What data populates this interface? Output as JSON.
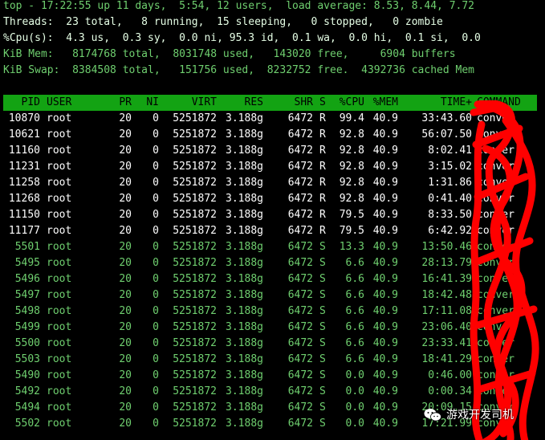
{
  "summary": {
    "line1": "top - 17:22:55 up 11 days,  5:54, 12 users,  load average: 8.53, 8.44, 7.72",
    "line2": "Threads:  23 total,   8 running,  15 sleeping,   0 stopped,   0 zombie",
    "line3": "%Cpu(s):  4.3 us,  0.3 sy,  0.0 ni, 95.3 id,  0.1 wa,  0.0 hi,  0.1 si,  0.0",
    "line4": "KiB Mem:   8174768 total,  8031748 used,   143020 free,     6904 buffers",
    "line5": "KiB Swap:  8384508 total,   151756 used,  8232752 free.  4392736 cached Mem"
  },
  "table": {
    "columns": [
      "PID",
      "USER",
      "PR",
      "NI",
      "VIRT",
      "RES",
      "SHR",
      "S",
      "%CPU",
      "%MEM",
      "TIME+",
      "COMMAND"
    ],
    "rows": [
      {
        "pid": "10870",
        "user": "root",
        "pr": "20",
        "ni": "0",
        "virt": "5251872",
        "res": "3.188g",
        "shr": "6472",
        "s": "R",
        "cpu": "99.4",
        "mem": "40.9",
        "time": "33:43.60",
        "cmd": "conver",
        "state": "running"
      },
      {
        "pid": "10621",
        "user": "root",
        "pr": "20",
        "ni": "0",
        "virt": "5251872",
        "res": "3.188g",
        "shr": "6472",
        "s": "R",
        "cpu": "92.8",
        "mem": "40.9",
        "time": "56:07.50",
        "cmd": "conver",
        "state": "running"
      },
      {
        "pid": "11160",
        "user": "root",
        "pr": "20",
        "ni": "0",
        "virt": "5251872",
        "res": "3.188g",
        "shr": "6472",
        "s": "R",
        "cpu": "92.8",
        "mem": "40.9",
        "time": "8:02.41",
        "cmd": "conver",
        "state": "running"
      },
      {
        "pid": "11231",
        "user": "root",
        "pr": "20",
        "ni": "0",
        "virt": "5251872",
        "res": "3.188g",
        "shr": "6472",
        "s": "R",
        "cpu": "92.8",
        "mem": "40.9",
        "time": "3:15.02",
        "cmd": "conver",
        "state": "running"
      },
      {
        "pid": "11258",
        "user": "root",
        "pr": "20",
        "ni": "0",
        "virt": "5251872",
        "res": "3.188g",
        "shr": "6472",
        "s": "R",
        "cpu": "92.8",
        "mem": "40.9",
        "time": "1:31.86",
        "cmd": "conver",
        "state": "running"
      },
      {
        "pid": "11268",
        "user": "root",
        "pr": "20",
        "ni": "0",
        "virt": "5251872",
        "res": "3.188g",
        "shr": "6472",
        "s": "R",
        "cpu": "92.8",
        "mem": "40.9",
        "time": "0:41.40",
        "cmd": "conver",
        "state": "running"
      },
      {
        "pid": "11150",
        "user": "root",
        "pr": "20",
        "ni": "0",
        "virt": "5251872",
        "res": "3.188g",
        "shr": "6472",
        "s": "R",
        "cpu": "79.5",
        "mem": "40.9",
        "time": "8:33.50",
        "cmd": "conver",
        "state": "running"
      },
      {
        "pid": "11177",
        "user": "root",
        "pr": "20",
        "ni": "0",
        "virt": "5251872",
        "res": "3.188g",
        "shr": "6472",
        "s": "R",
        "cpu": "79.5",
        "mem": "40.9",
        "time": "6:42.92",
        "cmd": "conver",
        "state": "running"
      },
      {
        "pid": "5501",
        "user": "root",
        "pr": "20",
        "ni": "0",
        "virt": "5251872",
        "res": "3.188g",
        "shr": "6472",
        "s": "S",
        "cpu": "13.3",
        "mem": "40.9",
        "time": "13:50.46",
        "cmd": "conver",
        "state": "sleeping"
      },
      {
        "pid": "5495",
        "user": "root",
        "pr": "20",
        "ni": "0",
        "virt": "5251872",
        "res": "3.188g",
        "shr": "6472",
        "s": "S",
        "cpu": "6.6",
        "mem": "40.9",
        "time": "28:13.79",
        "cmd": "conver",
        "state": "sleeping"
      },
      {
        "pid": "5496",
        "user": "root",
        "pr": "20",
        "ni": "0",
        "virt": "5251872",
        "res": "3.188g",
        "shr": "6472",
        "s": "S",
        "cpu": "6.6",
        "mem": "40.9",
        "time": "16:41.39",
        "cmd": "conver",
        "state": "sleeping"
      },
      {
        "pid": "5497",
        "user": "root",
        "pr": "20",
        "ni": "0",
        "virt": "5251872",
        "res": "3.188g",
        "shr": "6472",
        "s": "S",
        "cpu": "6.6",
        "mem": "40.9",
        "time": "18:42.48",
        "cmd": "conver",
        "state": "sleeping"
      },
      {
        "pid": "5498",
        "user": "root",
        "pr": "20",
        "ni": "0",
        "virt": "5251872",
        "res": "3.188g",
        "shr": "6472",
        "s": "S",
        "cpu": "6.6",
        "mem": "40.9",
        "time": "17:11.08",
        "cmd": "conver",
        "state": "sleeping"
      },
      {
        "pid": "5499",
        "user": "root",
        "pr": "20",
        "ni": "0",
        "virt": "5251872",
        "res": "3.188g",
        "shr": "6472",
        "s": "S",
        "cpu": "6.6",
        "mem": "40.9",
        "time": "23:06.40",
        "cmd": "conver",
        "state": "sleeping"
      },
      {
        "pid": "5500",
        "user": "root",
        "pr": "20",
        "ni": "0",
        "virt": "5251872",
        "res": "3.188g",
        "shr": "6472",
        "s": "S",
        "cpu": "6.6",
        "mem": "40.9",
        "time": "23:33.41",
        "cmd": "conver",
        "state": "sleeping"
      },
      {
        "pid": "5503",
        "user": "root",
        "pr": "20",
        "ni": "0",
        "virt": "5251872",
        "res": "3.188g",
        "shr": "6472",
        "s": "S",
        "cpu": "6.6",
        "mem": "40.9",
        "time": "18:41.29",
        "cmd": "conver",
        "state": "sleeping"
      },
      {
        "pid": "5490",
        "user": "root",
        "pr": "20",
        "ni": "0",
        "virt": "5251872",
        "res": "3.188g",
        "shr": "6472",
        "s": "S",
        "cpu": "0.0",
        "mem": "40.9",
        "time": "0:46.00",
        "cmd": "conver",
        "state": "sleeping"
      },
      {
        "pid": "5492",
        "user": "root",
        "pr": "20",
        "ni": "0",
        "virt": "5251872",
        "res": "3.188g",
        "shr": "6472",
        "s": "S",
        "cpu": "0.0",
        "mem": "40.9",
        "time": "0:00.34",
        "cmd": "conver",
        "state": "sleeping"
      },
      {
        "pid": "5494",
        "user": "root",
        "pr": "20",
        "ni": "0",
        "virt": "5251872",
        "res": "3.188g",
        "shr": "6472",
        "s": "S",
        "cpu": "0.0",
        "mem": "40.9",
        "time": "20:09.15",
        "cmd": "conver",
        "state": "sleeping"
      },
      {
        "pid": "5502",
        "user": "root",
        "pr": "20",
        "ni": "0",
        "virt": "5251872",
        "res": "3.188g",
        "shr": "6472",
        "s": "S",
        "cpu": "0.0",
        "mem": "40.9",
        "time": "17:21.99",
        "cmd": "conver",
        "state": "sleeping"
      }
    ]
  },
  "watermark": {
    "text": "游戏开发司机",
    "icon": "wechat-icon"
  },
  "colors": {
    "header_bar": "#13a313",
    "running_text": "#ffffff",
    "sleeping_text": "#6fcf6f",
    "redaction": "#ff0000"
  }
}
